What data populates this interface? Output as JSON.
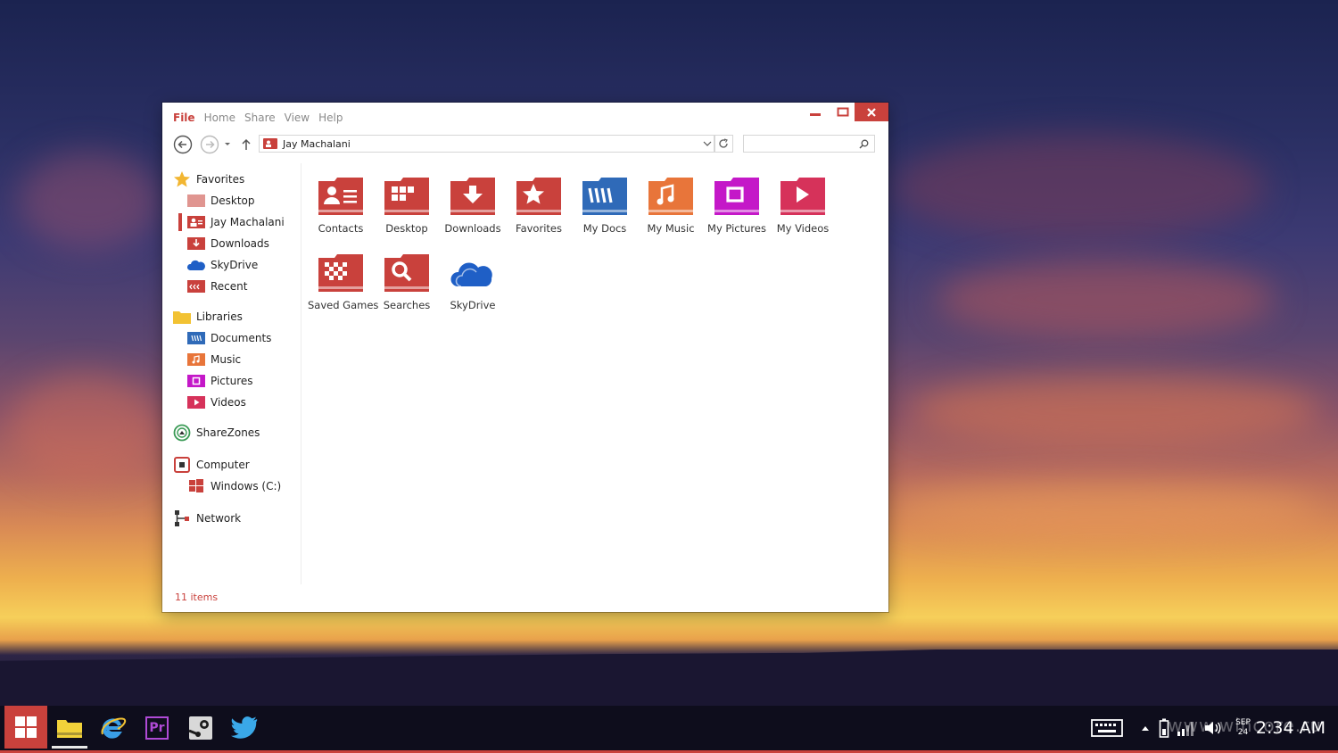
{
  "window": {
    "menu": [
      "File",
      "Home",
      "Share",
      "View",
      "Help"
    ],
    "active_menu": "File",
    "address": "Jay Machalani",
    "search_placeholder": "",
    "status": "11 items"
  },
  "sidebar": {
    "favorites": {
      "label": "Favorites",
      "items": [
        "Desktop",
        "Jay Machalani",
        "Downloads",
        "SkyDrive",
        "Recent"
      ]
    },
    "libraries": {
      "label": "Libraries",
      "items": [
        "Documents",
        "Music",
        "Pictures",
        "Videos"
      ]
    },
    "sharezones": {
      "label": "ShareZones"
    },
    "computer": {
      "label": "Computer",
      "items": [
        "Windows (C:)"
      ]
    },
    "network": {
      "label": "Network"
    },
    "selected": "Jay Machalani"
  },
  "folders": [
    {
      "label": "Contacts",
      "icon": "contacts-folder-icon",
      "color": "#c9413c"
    },
    {
      "label": "Desktop",
      "icon": "desktop-folder-icon",
      "color": "#c9413c"
    },
    {
      "label": "Downloads",
      "icon": "downloads-folder-icon",
      "color": "#c9413c"
    },
    {
      "label": "Favorites",
      "icon": "favorites-folder-icon",
      "color": "#c9413c"
    },
    {
      "label": "My Docs",
      "icon": "docs-folder-icon",
      "color": "#2f6ab8"
    },
    {
      "label": "My Music",
      "icon": "music-folder-icon",
      "color": "#e8753a"
    },
    {
      "label": "My Pictures",
      "icon": "pictures-folder-icon",
      "color": "#c418c8"
    },
    {
      "label": "My Videos",
      "icon": "videos-folder-icon",
      "color": "#d6325a"
    },
    {
      "label": "Saved Games",
      "icon": "saved-games-folder-icon",
      "color": "#c9413c"
    },
    {
      "label": "Searches",
      "icon": "searches-folder-icon",
      "color": "#c9413c"
    },
    {
      "label": "SkyDrive",
      "icon": "skydrive-icon",
      "color": "#1f5fc6"
    }
  ],
  "taskbar": {
    "apps": [
      "File Explorer",
      "Internet Explorer",
      "Premiere",
      "Steam",
      "Twitter"
    ],
    "premiere_label": "Pr",
    "clock": {
      "month": "SEP",
      "day": "24",
      "time": "2:34 AM"
    },
    "watermark": "www.wincore.ru"
  },
  "colors": {
    "accent": "#c9413c",
    "taskbar": "#0e0d1c"
  }
}
